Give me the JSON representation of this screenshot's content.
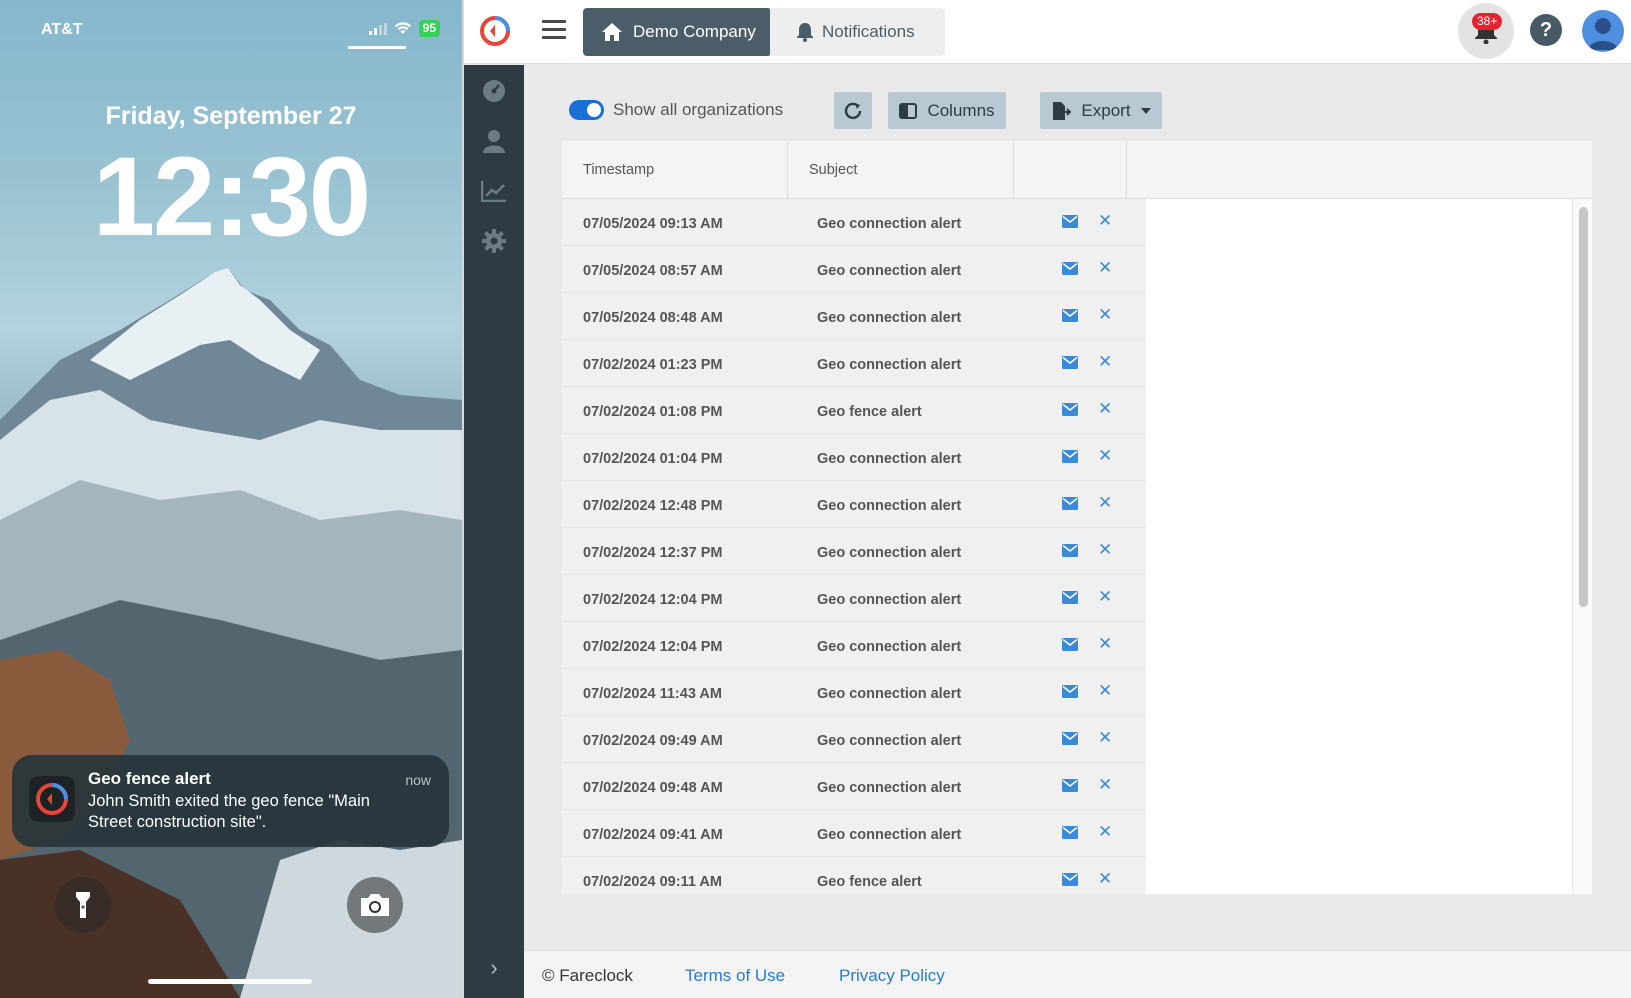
{
  "phone": {
    "carrier": "AT&T",
    "battery": "95",
    "date": "Friday, September 27",
    "time": "12:30",
    "notification": {
      "title": "Geo fence alert",
      "time": "now",
      "body": "John Smith exited the geo fence \"Main Street construction site\"."
    },
    "icons": [
      "signal-icon",
      "wifi-icon",
      "battery-icon",
      "flashlight-icon",
      "camera-icon"
    ]
  },
  "app": {
    "breadcrumb": {
      "home_label": "Demo Company",
      "current_label": "Notifications"
    },
    "notification_count": "38+",
    "help_label": "?",
    "sidebar": {
      "items": [
        "dashboard-icon",
        "users-icon",
        "reports-icon",
        "settings-icon"
      ]
    },
    "toolbar": {
      "toggle_label": "Show all organizations",
      "toggle_on": true,
      "columns_label": "Columns",
      "export_label": "Export"
    },
    "table": {
      "headers": [
        "Timestamp",
        "Subject"
      ],
      "rows": [
        {
          "timestamp": "07/05/2024 09:13 AM",
          "subject": "Geo connection alert"
        },
        {
          "timestamp": "07/05/2024 08:57 AM",
          "subject": "Geo connection alert"
        },
        {
          "timestamp": "07/05/2024 08:48 AM",
          "subject": "Geo connection alert"
        },
        {
          "timestamp": "07/02/2024 01:23 PM",
          "subject": "Geo connection alert"
        },
        {
          "timestamp": "07/02/2024 01:08 PM",
          "subject": "Geo fence alert"
        },
        {
          "timestamp": "07/02/2024 01:04 PM",
          "subject": "Geo connection alert"
        },
        {
          "timestamp": "07/02/2024 12:48 PM",
          "subject": "Geo connection alert"
        },
        {
          "timestamp": "07/02/2024 12:37 PM",
          "subject": "Geo connection alert"
        },
        {
          "timestamp": "07/02/2024 12:04 PM",
          "subject": "Geo connection alert"
        },
        {
          "timestamp": "07/02/2024 12:04 PM",
          "subject": "Geo connection alert"
        },
        {
          "timestamp": "07/02/2024 11:43 AM",
          "subject": "Geo connection alert"
        },
        {
          "timestamp": "07/02/2024 09:49 AM",
          "subject": "Geo connection alert"
        },
        {
          "timestamp": "07/02/2024 09:48 AM",
          "subject": "Geo connection alert"
        },
        {
          "timestamp": "07/02/2024 09:41 AM",
          "subject": "Geo connection alert"
        },
        {
          "timestamp": "07/02/2024 09:11 AM",
          "subject": "Geo fence alert"
        }
      ]
    },
    "footer": {
      "copyright": "© Fareclock",
      "terms": "Terms of Use",
      "privacy": "Privacy Policy"
    },
    "colors": {
      "sidebar": "#2e3b42",
      "breadcrumb_active": "#4b5d68",
      "accent": "#1a6fd6",
      "link": "#2b7bd0",
      "badge": "#e5242f"
    }
  }
}
